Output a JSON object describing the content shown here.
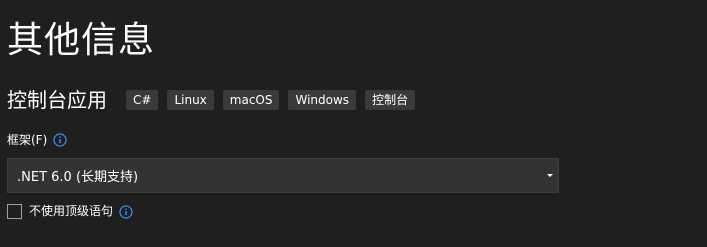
{
  "page": {
    "title": "其他信息",
    "project_type": "控制台应用"
  },
  "tags": [
    "C#",
    "Linux",
    "macOS",
    "Windows",
    "控制台"
  ],
  "framework": {
    "label": "框架(F)",
    "selected": ".NET 6.0 (长期支持)"
  },
  "options": {
    "top_level_statements_label": "不使用顶级语句",
    "top_level_statements_checked": false
  },
  "colors": {
    "background": "#1f1f1f",
    "tag_background": "#3a3a3a",
    "select_background": "#333333",
    "info_icon": "#3794ff"
  }
}
